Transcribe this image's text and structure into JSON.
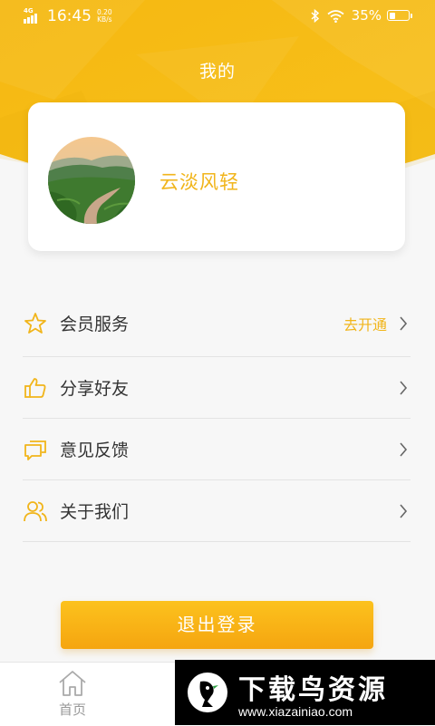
{
  "status_bar": {
    "network": "4G",
    "time": "16:45",
    "speed_value": "0.20",
    "speed_unit": "KB/s",
    "battery_percent_text": "35%",
    "battery_level": 0.35
  },
  "header": {
    "title": "我的"
  },
  "profile": {
    "username": "云淡风轻"
  },
  "menu": {
    "items": [
      {
        "label": "会员服务",
        "icon": "star-icon",
        "extra": "去开通"
      },
      {
        "label": "分享好友",
        "icon": "thumbs-up-icon"
      },
      {
        "label": "意见反馈",
        "icon": "feedback-icon"
      },
      {
        "label": "关于我们",
        "icon": "users-icon"
      }
    ]
  },
  "logout": {
    "label": "退出登录"
  },
  "tab_bar": {
    "home_label": "首页"
  },
  "watermark": {
    "title": "下载鸟资源",
    "url": "www.xiazainiao.com"
  },
  "colors": {
    "accent": "#f1b51b",
    "header": "#f6bc16",
    "button": "#f9b418"
  }
}
